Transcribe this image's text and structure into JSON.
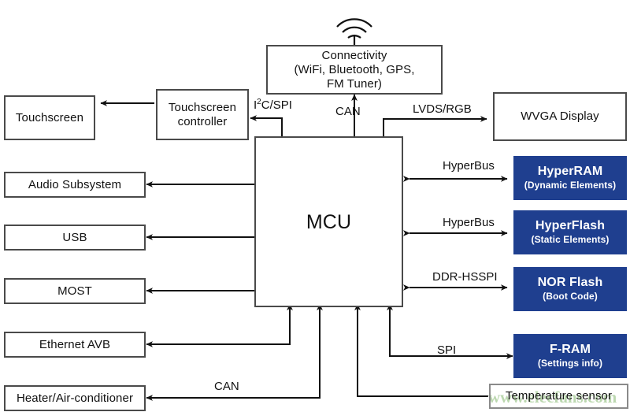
{
  "diagram": {
    "title": "Automotive Infotainment MCU Block Diagram",
    "accent_blue": "#1f3f8f",
    "box_border": "#4a4a4a",
    "sensor_border": "#8a8a8a",
    "watermark_color": "#bcd8b0",
    "watermark_text": "www.elecfans.com"
  },
  "nodes": {
    "antenna": "antenna-icon",
    "connectivity": {
      "line1": "Connectivity",
      "line2": "(WiFi, Bluetooth, GPS,",
      "line3": "FM Tuner)"
    },
    "touchscreen": "Touchscreen",
    "touchscreen_controller": {
      "line1": "Touchscreen",
      "line2": "controller"
    },
    "audio_subsystem": "Audio Subsystem",
    "usb": "USB",
    "most": "MOST",
    "ethernet_avb": "Ethernet AVB",
    "heater": "Heater/Air-conditioner",
    "mcu": "MCU",
    "wvga_display": "WVGA Display",
    "hyperram": {
      "name": "HyperRAM",
      "sub": "(Dynamic Elements)"
    },
    "hyperflash": {
      "name": "HyperFlash",
      "sub": "(Static Elements)"
    },
    "nor_flash": {
      "name": "NOR Flash",
      "sub": "(Boot Code)"
    },
    "fram": {
      "name": "F-RAM",
      "sub": "(Settings info)"
    },
    "temperature_sensor": "Temperature sensor"
  },
  "edge_labels": {
    "i2c_spi_pre": "I",
    "i2c_spi_sup": "2",
    "i2c_spi_post": "C/SPI",
    "can_top": "CAN",
    "lvds_rgb": "LVDS/RGB",
    "hyperbus_ram": "HyperBus",
    "hyperbus_flash": "HyperBus",
    "ddr_hsspi": "DDR-HSSPI",
    "spi": "SPI",
    "can_bottom": "CAN"
  }
}
